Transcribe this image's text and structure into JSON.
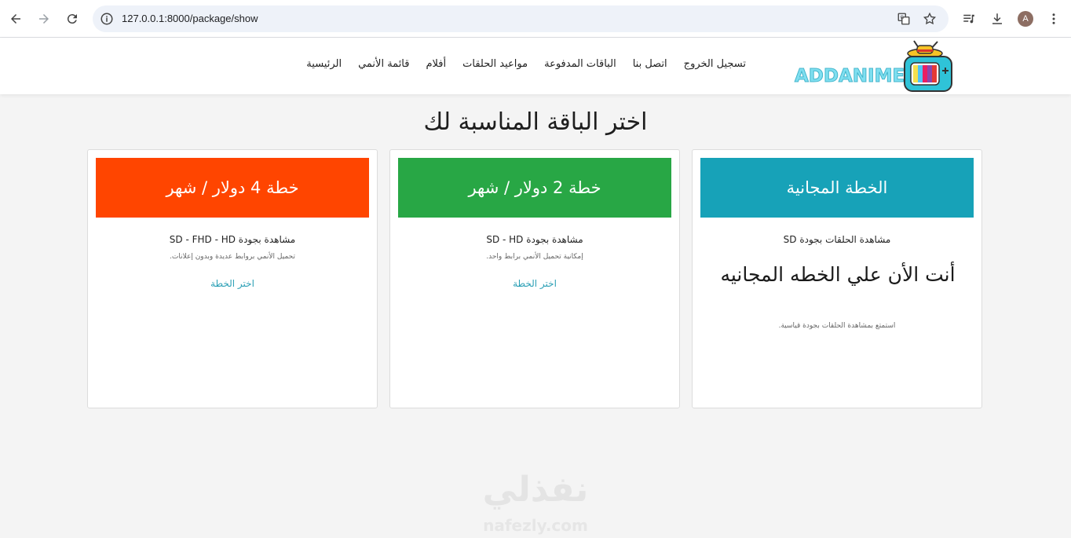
{
  "browser": {
    "url": "127.0.0.1:8000/package/show",
    "avatar_letter": "A"
  },
  "site": {
    "logo_text": "ADDANIME",
    "nav": [
      {
        "label": "الرئيسية"
      },
      {
        "label": "قائمة الأنمي"
      },
      {
        "label": "أفلام"
      },
      {
        "label": "مواعيد الحلقات"
      },
      {
        "label": "الباقات المدفوعة"
      },
      {
        "label": "اتصل بنا"
      },
      {
        "label": "تسجيل الخروج"
      }
    ]
  },
  "page": {
    "title": "اختر الباقة المناسبة لك"
  },
  "plans": {
    "free": {
      "header": "الخطة المجانية",
      "color": "#17a2b8",
      "feature": "مشاهدة الحلقات بجودة SD",
      "current_text": "أنت الأن علي الخطه المجانيه",
      "note": "استمتع بمشاهدة الحلقات بجودة قياسية."
    },
    "plan2": {
      "header": "خطة 2 دولار / شهر",
      "color": "#28a745",
      "feature": "مشاهدة بجودة SD - HD",
      "note": "إمكانية تحميل الأنمي برابط واحد.",
      "link": "اختر الخطة"
    },
    "plan4": {
      "header": "خطة 4 دولار / شهر",
      "color": "#ff4500",
      "feature": "مشاهدة بجودة SD - FHD - HD",
      "note": "تحميل الأنمي بروابط عديدة وبدون إعلانات.",
      "link": "اختر الخطة"
    }
  },
  "watermark": {
    "arabic": "نفذلي",
    "latin": "nafezly.com"
  }
}
